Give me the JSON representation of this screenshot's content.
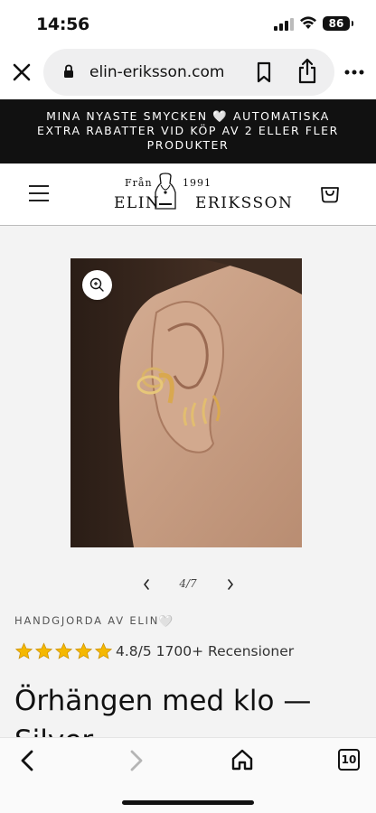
{
  "status_bar": {
    "time": "14:56",
    "battery": "86"
  },
  "browser": {
    "url": "elin-eriksson.com",
    "tab_count": "10"
  },
  "promo": {
    "line1": "MINA NYASTE SMYCKEN 🤍 AUTOMATISKA",
    "line2": "EXTRA RABATTER VID KÖP AV 2 ELLER FLER",
    "line3": "PRODUKTER"
  },
  "logo": {
    "from": "Från",
    "year": "1991",
    "name_first": "ELIN",
    "name_last": "ERIKSSON"
  },
  "product": {
    "image_counter": "4/7",
    "vendor": "HANDGJORDA AV ELIN",
    "vendor_heart": "🤍",
    "rating_text": "4.8/5 1700+ Recensioner",
    "stars": 5,
    "title": "Örhängen med klo — Silver"
  },
  "colors": {
    "banner_bg": "#111111",
    "star": "#f5b800",
    "product_bg": "#f3f3f3"
  },
  "icons": [
    "close-icon",
    "lock-icon",
    "bookmark-icon",
    "share-icon",
    "more-icon",
    "menu-icon",
    "cart-icon",
    "zoom-icon",
    "chevron-left-icon",
    "chevron-right-icon",
    "star-icon",
    "back-icon",
    "forward-icon",
    "home-icon",
    "tabs-icon"
  ]
}
